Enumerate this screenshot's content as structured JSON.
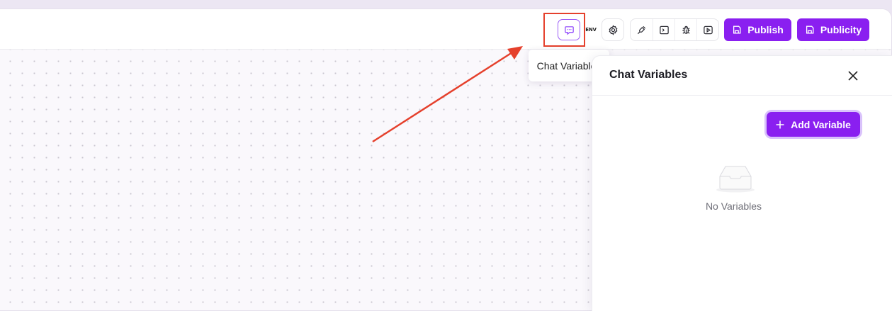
{
  "header": {
    "env_label": "ENV",
    "publish_label": "Publish",
    "publicity_label": "Publicity",
    "accent_color": "#8a1ff0"
  },
  "toolbar": {
    "icons": [
      "chat-variables-icon",
      "env-icon",
      "settings-icon",
      "plugin-icon",
      "terminal-icon",
      "debug-bug-icon",
      "run-play-icon"
    ]
  },
  "tooltip": {
    "text": "Chat Variables"
  },
  "annotation": {
    "color": "#e5402c"
  },
  "panel": {
    "title": "Chat Variables",
    "add_button_label": "Add Variable",
    "empty_text": "No Variables"
  }
}
